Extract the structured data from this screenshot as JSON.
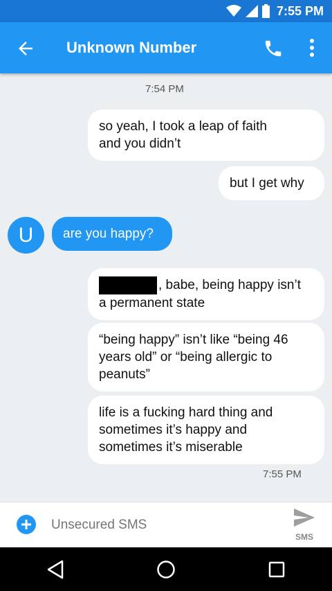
{
  "status_bar": {
    "time": "7:55 PM"
  },
  "app_bar": {
    "title": "Unknown Number"
  },
  "conversation": {
    "timestamp_top": "7:54 PM",
    "timestamp_bottom": "7:55 PM",
    "contact_initial": "U",
    "messages": [
      {
        "direction": "outgoing",
        "lines": [
          "so yeah, I took a leap of faith",
          "and you didn’t"
        ]
      },
      {
        "direction": "outgoing",
        "lines": [
          "but I get why"
        ]
      },
      {
        "direction": "incoming",
        "lines": [
          "are you happy?"
        ]
      },
      {
        "direction": "outgoing",
        "lines": [
          ", babe, being happy isn’t",
          "a permanent state"
        ],
        "redacted_prefix": true
      },
      {
        "direction": "outgoing",
        "lines": [
          "“being happy” isn’t like “being 46",
          "years old” or “being allergic to",
          "peanuts”"
        ]
      },
      {
        "direction": "outgoing",
        "lines": [
          "life is a fucking hard thing and",
          "sometimes it’s happy and",
          "sometimes it’s miserable"
        ]
      }
    ]
  },
  "composer": {
    "placeholder": "Unsecured SMS",
    "send_label": "SMS"
  },
  "colors": {
    "primary": "#2196f3",
    "primary_dark": "#1976d2",
    "background": "#eceff1"
  }
}
